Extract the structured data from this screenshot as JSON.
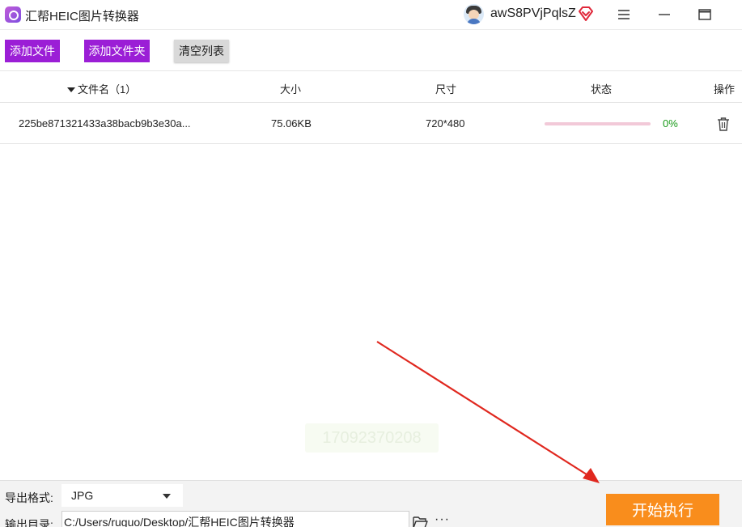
{
  "app": {
    "title": "汇帮HEIC图片转换器",
    "username": "awS8PVjPqlsZ"
  },
  "window_controls": {
    "menu_icon": "hamburger-menu-icon",
    "minimize_icon": "minimize-icon",
    "maximize_icon": "maximize-icon"
  },
  "toolbar": {
    "add_file_label": "添加文件",
    "add_folder_label": "添加文件夹",
    "clear_list_label": "清空列表"
  },
  "table": {
    "columns": {
      "filename": "文件名（1）",
      "size": "大小",
      "dimensions": "尺寸",
      "status": "状态",
      "action": "操作"
    },
    "rows": [
      {
        "filename": "225be871321433a38bacb9b3e30a...",
        "size": "75.06KB",
        "dimensions": "720*480",
        "progress": 0,
        "progress_text": "0%",
        "action_icon": "trash-icon"
      }
    ]
  },
  "watermark": {
    "text": "17092370208"
  },
  "bottom": {
    "format_label": "导出格式:",
    "format_value": "JPG",
    "output_label": "输出目录:",
    "output_path": "C:/Users/ruguo/Desktop/汇帮HEIC图片转换器",
    "more_label": "···",
    "start_label": "开始执行"
  },
  "colors": {
    "accent_purple": "#9b1ed6",
    "start_orange": "#f98d1c",
    "progress_green": "#1a9a1a",
    "annotation_red": "#e0281f"
  }
}
